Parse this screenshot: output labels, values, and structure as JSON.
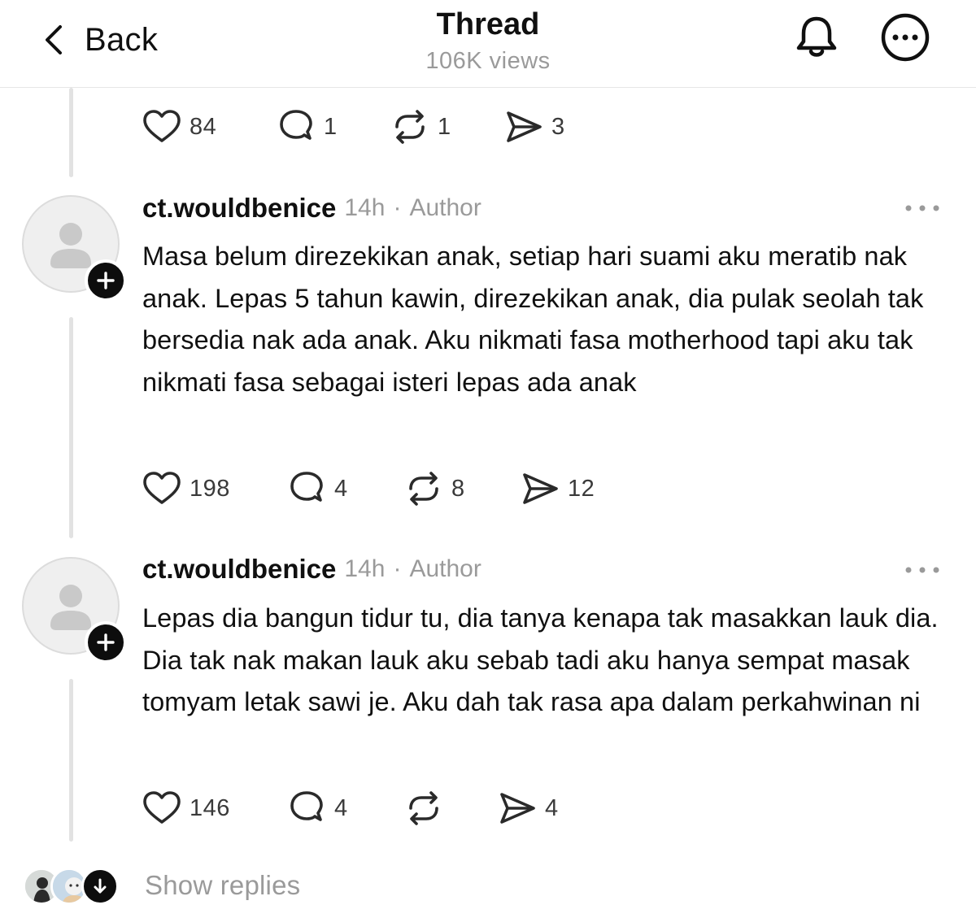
{
  "header": {
    "back_label": "Back",
    "title": "Thread",
    "views": "106K views"
  },
  "top_actions": {
    "likes": "84",
    "comments": "1",
    "reposts": "1",
    "shares": "3"
  },
  "posts": [
    {
      "username": "ct.wouldbenice",
      "time": "14h",
      "separator": "·",
      "badge": "Author",
      "text": "Masa belum direzekikan anak, setiap hari suami aku meratib nak anak. Lepas 5 tahun kawin, direzekikan anak, dia pulak seolah tak bersedia nak ada anak. Aku nikmati fasa motherhood tapi aku tak nikmati fasa sebagai isteri lepas ada anak",
      "likes": "198",
      "comments": "4",
      "reposts": "8",
      "shares": "12"
    },
    {
      "username": "ct.wouldbenice",
      "time": "14h",
      "separator": "·",
      "badge": "Author",
      "text": "Lepas dia bangun tidur tu, dia tanya kenapa tak masakkan lauk dia. Dia tak nak makan lauk aku sebab tadi aku hanya sempat masak tomyam letak sawi je. Aku dah tak rasa apa dalam perkahwinan ni",
      "likes": "146",
      "comments": "4",
      "reposts": "",
      "shares": "4"
    }
  ],
  "show_replies_label": "Show replies",
  "colors": {
    "text": "#101010",
    "muted": "#9a9a9a",
    "thread_line": "#e2e2e2",
    "divider": "#e6e6e6"
  }
}
